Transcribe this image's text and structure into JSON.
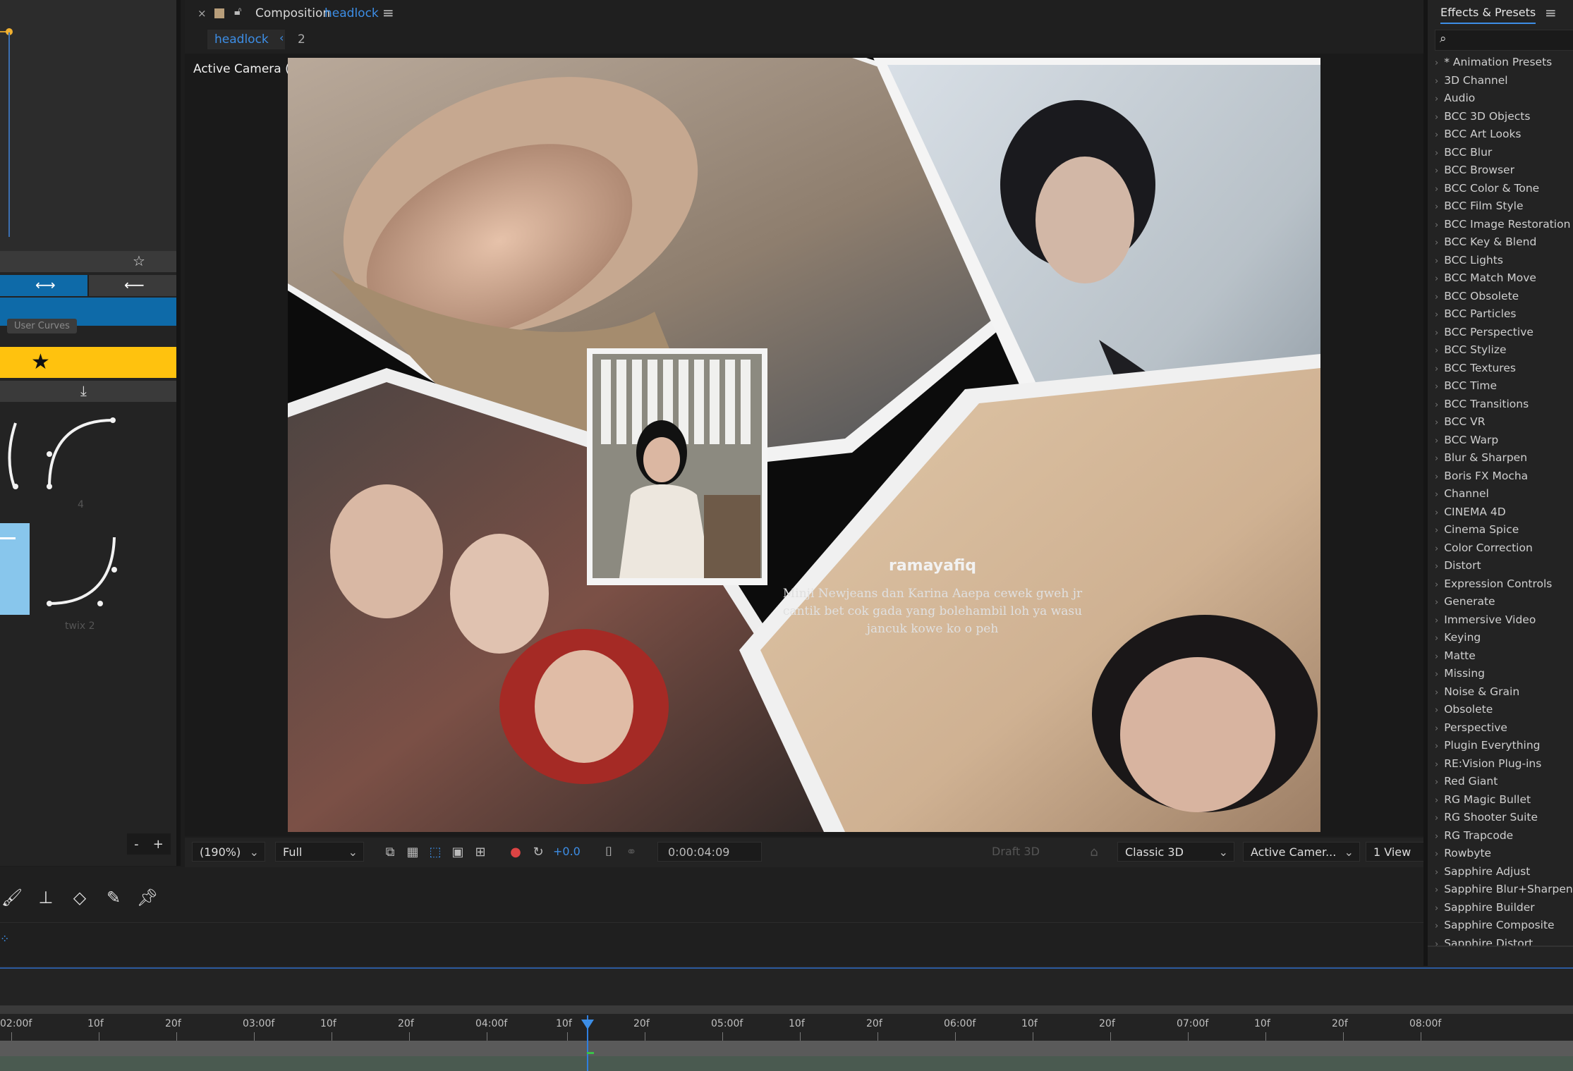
{
  "composition": {
    "close_glyph": "×",
    "label": "Composition",
    "name": "headlock",
    "menu_glyph": "≡",
    "breadcrumb": [
      "headlock",
      "2"
    ],
    "viewer_label": "Active Camera (Default)"
  },
  "overlay": {
    "username": "ramayafiq",
    "caption_line1": "Minji Newjeans dan Karina Aaepa cewek gweh jr",
    "caption_line2": "cantik bet cok gada yang bolehambil loh ya wasu",
    "caption_line3": "jancuk kowe ko o peh"
  },
  "left_panel": {
    "tooltip": "User Curves",
    "curve_labels": [
      "4",
      "twix 2"
    ],
    "minus": "-",
    "plus": "+"
  },
  "viewer_toolbar": {
    "zoom": "(190%)",
    "resolution": "Full",
    "exposure": "+0.0",
    "timecode": "0:00:04:09",
    "draft3d": "Draft 3D",
    "renderer": "Classic 3D",
    "camera": "Active Camer...",
    "views": "1 View"
  },
  "effects_panel": {
    "title": "Effects & Presets",
    "menu_glyph": "≡",
    "items": [
      "* Animation Presets",
      "3D Channel",
      "Audio",
      "BCC 3D Objects",
      "BCC Art Looks",
      "BCC Blur",
      "BCC Browser",
      "BCC Color & Tone",
      "BCC Film Style",
      "BCC Image Restoration",
      "BCC Key & Blend",
      "BCC Lights",
      "BCC Match Move",
      "BCC Obsolete",
      "BCC Particles",
      "BCC Perspective",
      "BCC Stylize",
      "BCC Textures",
      "BCC Time",
      "BCC Transitions",
      "BCC VR",
      "BCC Warp",
      "Blur & Sharpen",
      "Boris FX Mocha",
      "Channel",
      "CINEMA 4D",
      "Cinema Spice",
      "Color Correction",
      "Distort",
      "Expression Controls",
      "Generate",
      "Immersive Video",
      "Keying",
      "Matte",
      "Missing",
      "Noise & Grain",
      "Obsolete",
      "Perspective",
      "Plugin Everything",
      "RE:Vision Plug-ins",
      "Red Giant",
      "RG Magic Bullet",
      "RG Shooter Suite",
      "RG Trapcode",
      "Rowbyte",
      "Sapphire Adjust",
      "Sapphire Blur+Sharpen",
      "Sapphire Builder",
      "Sapphire Composite",
      "Sapphire Distort"
    ]
  },
  "timeline": {
    "ticks": [
      "02:00f",
      "10f",
      "20f",
      "03:00f",
      "10f",
      "20f",
      "04:00f",
      "10f",
      "20f",
      "05:00f",
      "10f",
      "20f",
      "06:00f",
      "10f",
      "20f",
      "07:00f",
      "10f",
      "20f",
      "08:00f"
    ]
  },
  "colors": {
    "accent_blue": "#3d8ee6",
    "button_blue": "#0e6aa8",
    "yellow": "#ffc20e",
    "panel_bg": "#232323"
  }
}
